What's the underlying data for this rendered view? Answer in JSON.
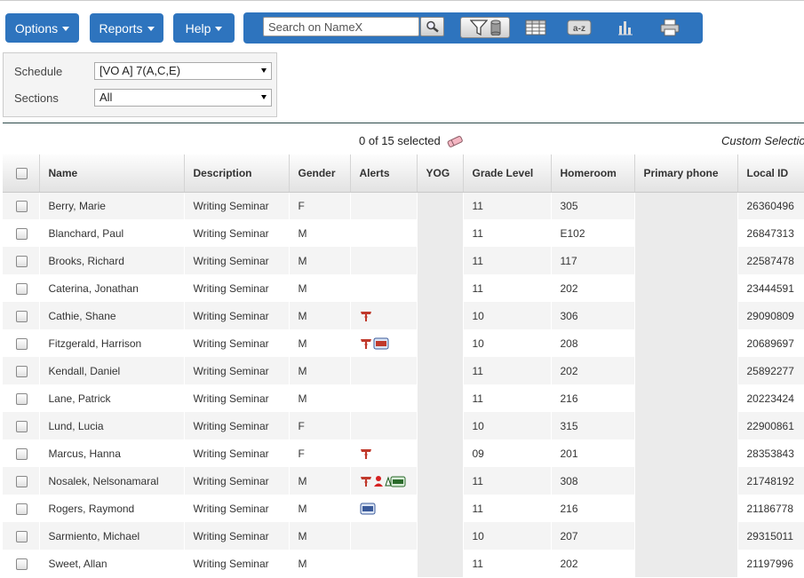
{
  "menu": {
    "options_label": "Options",
    "reports_label": "Reports",
    "help_label": "Help"
  },
  "toolbar": {
    "search_placeholder": "Search on NameX",
    "icons": [
      "search-icon",
      "filter-icon",
      "grid-icon",
      "sort-icon",
      "chart-icon",
      "print-icon"
    ]
  },
  "filters": {
    "schedule_label": "Schedule",
    "schedule_value": "[VO A] 7(A,C,E)",
    "sections_label": "Sections",
    "sections_value": "All"
  },
  "selection": {
    "text": "0 of 15 selected",
    "custom_label": "Custom Selection"
  },
  "table": {
    "columns": [
      "Name",
      "Description",
      "Gender",
      "Alerts",
      "YOG",
      "Grade Level",
      "Homeroom",
      "Primary phone",
      "Local ID"
    ],
    "rows": [
      {
        "name": "Berry, Marie",
        "description": "Writing Seminar",
        "gender": "F",
        "alerts": [],
        "grade": "11",
        "homeroom": "305",
        "local_id": "26360496"
      },
      {
        "name": "Blanchard, Paul",
        "description": "Writing Seminar",
        "gender": "M",
        "alerts": [],
        "grade": "11",
        "homeroom": "E102",
        "local_id": "26847313"
      },
      {
        "name": "Brooks, Richard",
        "description": "Writing Seminar",
        "gender": "M",
        "alerts": [],
        "grade": "11",
        "homeroom": "117",
        "local_id": "22587478"
      },
      {
        "name": "Caterina, Jonathan",
        "description": "Writing Seminar",
        "gender": "M",
        "alerts": [],
        "grade": "11",
        "homeroom": "202",
        "local_id": "23444591"
      },
      {
        "name": "Cathie, Shane",
        "description": "Writing Seminar",
        "gender": "M",
        "alerts": [
          "medical"
        ],
        "grade": "10",
        "homeroom": "306",
        "local_id": "29090809"
      },
      {
        "name": "Fitzgerald, Harrison",
        "description": "Writing Seminar",
        "gender": "M",
        "alerts": [
          "medical",
          "iep"
        ],
        "grade": "10",
        "homeroom": "208",
        "local_id": "20689697"
      },
      {
        "name": "Kendall, Daniel",
        "description": "Writing Seminar",
        "gender": "M",
        "alerts": [],
        "grade": "11",
        "homeroom": "202",
        "local_id": "25892277"
      },
      {
        "name": "Lane, Patrick",
        "description": "Writing Seminar",
        "gender": "M",
        "alerts": [],
        "grade": "11",
        "homeroom": "216",
        "local_id": "20223424"
      },
      {
        "name": "Lund, Lucia",
        "description": "Writing Seminar",
        "gender": "F",
        "alerts": [],
        "grade": "10",
        "homeroom": "315",
        "local_id": "22900861"
      },
      {
        "name": "Marcus, Hanna",
        "description": "Writing Seminar",
        "gender": "F",
        "alerts": [
          "medical"
        ],
        "grade": "09",
        "homeroom": "201",
        "local_id": "28353843"
      },
      {
        "name": "Nosalek, Nelsonamaral",
        "description": "Writing Seminar",
        "gender": "M",
        "alerts": [
          "medical",
          "person",
          "epp"
        ],
        "grade": "11",
        "homeroom": "308",
        "local_id": "21748192"
      },
      {
        "name": "Rogers, Raymond",
        "description": "Writing Seminar",
        "gender": "M",
        "alerts": [
          "504"
        ],
        "grade": "11",
        "homeroom": "216",
        "local_id": "21186778"
      },
      {
        "name": "Sarmiento, Michael",
        "description": "Writing Seminar",
        "gender": "M",
        "alerts": [],
        "grade": "10",
        "homeroom": "207",
        "local_id": "29315011"
      },
      {
        "name": "Sweet, Allan",
        "description": "Writing Seminar",
        "gender": "M",
        "alerts": [],
        "grade": "11",
        "homeroom": "202",
        "local_id": "21197996"
      }
    ]
  },
  "colors": {
    "brand_blue": "#2e74be",
    "alert_red": "#c0392b"
  }
}
